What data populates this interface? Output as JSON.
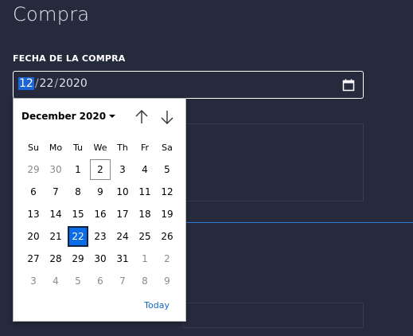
{
  "page": {
    "title": "Compra"
  },
  "field": {
    "label": "FECHA DE LA COMPRA",
    "month": "12",
    "day": "22",
    "year": "2020",
    "separator": "/",
    "icon": "calendar-icon"
  },
  "calendar": {
    "month_label": "December 2020",
    "weekdays": [
      "Su",
      "Mo",
      "Tu",
      "We",
      "Th",
      "Fr",
      "Sa"
    ],
    "weeks": [
      [
        {
          "d": "29",
          "o": true
        },
        {
          "d": "30",
          "o": true
        },
        {
          "d": "1"
        },
        {
          "d": "2",
          "today": true
        },
        {
          "d": "3"
        },
        {
          "d": "4"
        },
        {
          "d": "5"
        }
      ],
      [
        {
          "d": "6"
        },
        {
          "d": "7"
        },
        {
          "d": "8"
        },
        {
          "d": "9"
        },
        {
          "d": "10"
        },
        {
          "d": "11"
        },
        {
          "d": "12"
        }
      ],
      [
        {
          "d": "13"
        },
        {
          "d": "14"
        },
        {
          "d": "15"
        },
        {
          "d": "16"
        },
        {
          "d": "17"
        },
        {
          "d": "18"
        },
        {
          "d": "19"
        }
      ],
      [
        {
          "d": "20"
        },
        {
          "d": "21"
        },
        {
          "d": "22",
          "sel": true
        },
        {
          "d": "23"
        },
        {
          "d": "24"
        },
        {
          "d": "25"
        },
        {
          "d": "26"
        }
      ],
      [
        {
          "d": "27"
        },
        {
          "d": "28"
        },
        {
          "d": "29"
        },
        {
          "d": "30"
        },
        {
          "d": "31"
        },
        {
          "d": "1",
          "o": true
        },
        {
          "d": "2",
          "o": true
        }
      ],
      [
        {
          "d": "3",
          "o": true
        },
        {
          "d": "4",
          "o": true
        },
        {
          "d": "5",
          "o": true
        },
        {
          "d": "6",
          "o": true
        },
        {
          "d": "7",
          "o": true
        },
        {
          "d": "8",
          "o": true
        },
        {
          "d": "9",
          "o": true
        }
      ]
    ],
    "today_label": "Today",
    "colors": {
      "selected": "#0a6ce6",
      "link": "#1565c0",
      "other_month": "#8a8a8a"
    }
  },
  "theme": {
    "background": "#262a3d",
    "accent_line": "#2e7ad6"
  }
}
